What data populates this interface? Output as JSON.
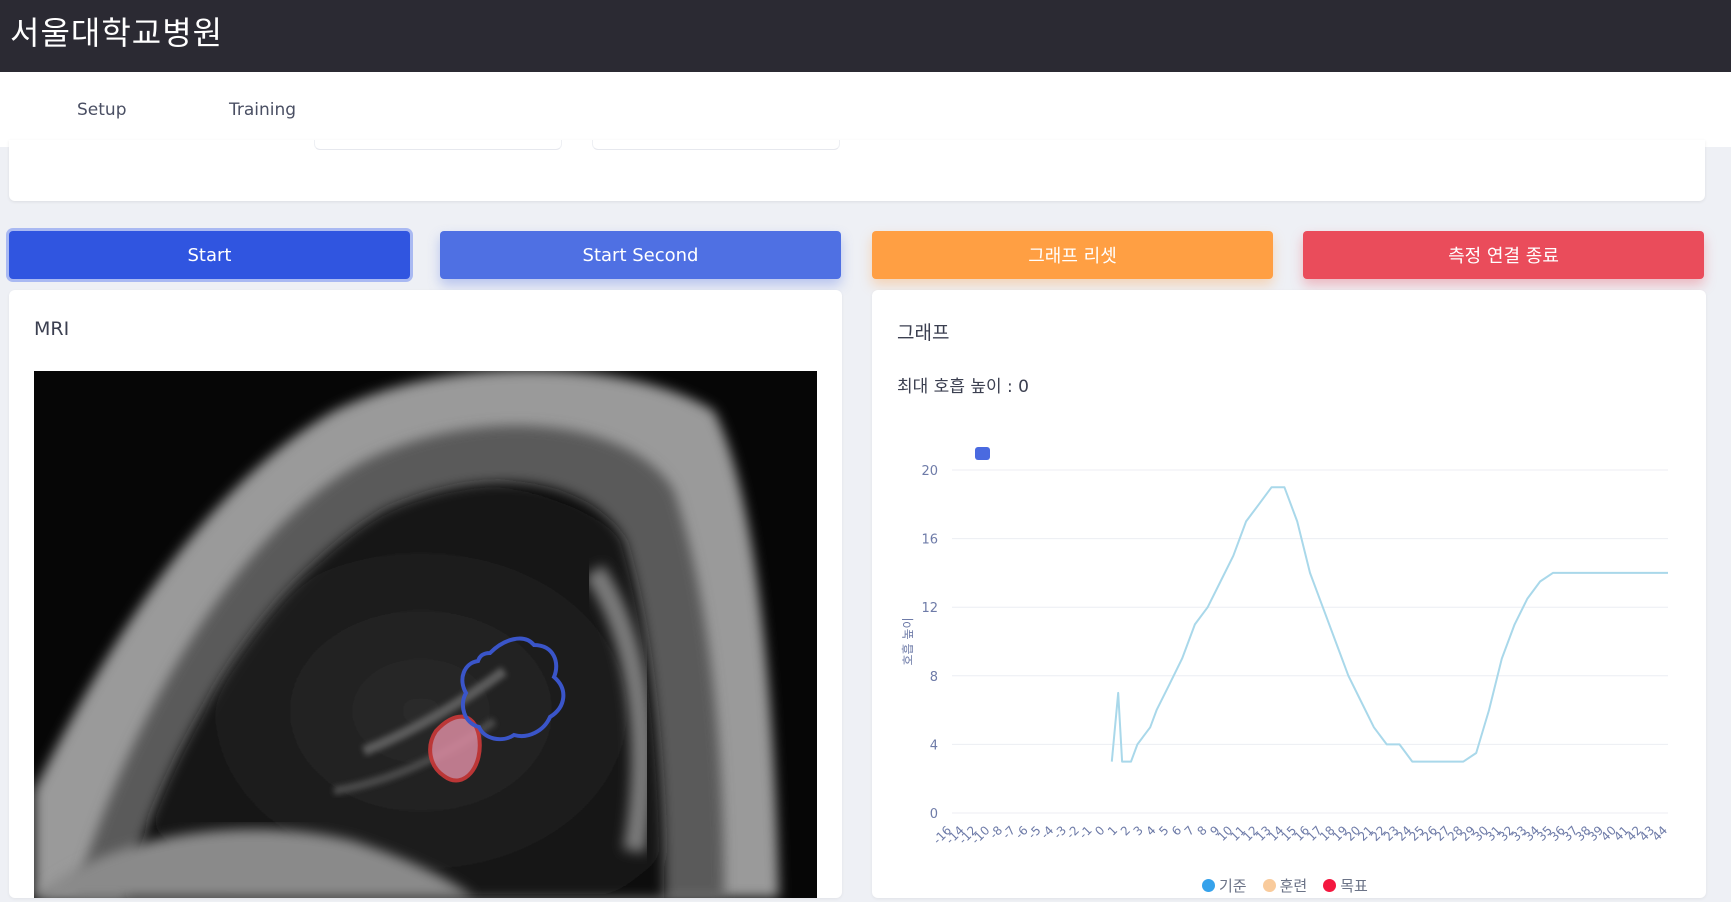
{
  "header": {
    "title": "서울대학교병원"
  },
  "nav": {
    "tabs": [
      {
        "label": "Setup"
      },
      {
        "label": "Training"
      }
    ]
  },
  "buttons": {
    "start": "Start",
    "start_second": "Start Second",
    "reset_graph": "그래프 리셋",
    "end_connection": "측정 연결 종료"
  },
  "mri": {
    "title": "MRI"
  },
  "graph": {
    "title": "그래프",
    "peak_label": "최대 호흡 높이 : 0"
  },
  "colors": {
    "primary": "#3055e0",
    "secondary": "#4f70e3",
    "warning": "#ff9f43",
    "danger": "#ea4c5b",
    "baseline_line": "#a9d8ea"
  },
  "chart_data": {
    "type": "line",
    "ylabel": "호흡 높이",
    "ylim": [
      0,
      20
    ],
    "yticks": [
      0,
      4,
      8,
      12,
      16,
      20
    ],
    "xticks": [
      "-16",
      "-14",
      "-12",
      "-10",
      "-8",
      "-7",
      "-6",
      "-5",
      "-4",
      "-3",
      "-2",
      "-1",
      "0",
      "1",
      "2",
      "3",
      "4",
      "5",
      "6",
      "7",
      "8",
      "9",
      "10",
      "11",
      "12",
      "13",
      "14",
      "15",
      "16",
      "17",
      "18",
      "19",
      "20",
      "21",
      "22",
      "23",
      "24",
      "25",
      "26",
      "27",
      "28",
      "29",
      "30",
      "31",
      "32",
      "33",
      "34",
      "35",
      "36",
      "37",
      "38",
      "39",
      "40",
      "41",
      "42",
      "43",
      "44"
    ],
    "legend": [
      "기준",
      "훈련",
      "목표"
    ],
    "legend_colors": [
      "#36a2eb",
      "#f9cb9c",
      "#f4173f"
    ],
    "legend_position": "bottom",
    "series": [
      {
        "name": "기준",
        "x": [
          0.5,
          1.0,
          1.3,
          1.6,
          2.0,
          2.5,
          3.0,
          3.5,
          4.0,
          5.0,
          6.0,
          7.0,
          8.0,
          9.0,
          10.0,
          11.0,
          12.0,
          13.0,
          14.0,
          15.0,
          16.0,
          17.0,
          18.0,
          19.0,
          20.0,
          21.0,
          22.0,
          23.0,
          24.0,
          25.0,
          26.0,
          27.0,
          28.0,
          29.0,
          30.0,
          31.0,
          32.0,
          33.0,
          34.0,
          35.0,
          36.0,
          37.0,
          38.0,
          39.0,
          40.0,
          41.0,
          42.0,
          43.0,
          44.0
        ],
        "y": [
          3,
          7,
          3,
          3,
          3,
          4,
          4.5,
          5,
          6,
          7.5,
          9,
          11,
          12,
          13.5,
          15,
          17,
          18,
          19,
          19,
          17,
          14,
          12,
          10,
          8,
          6.5,
          5,
          4,
          4,
          3,
          3,
          3,
          3,
          3,
          3.5,
          6,
          9,
          11,
          12.5,
          13.5,
          14,
          14,
          14,
          14,
          14,
          14,
          14,
          14,
          14,
          14
        ]
      }
    ]
  }
}
